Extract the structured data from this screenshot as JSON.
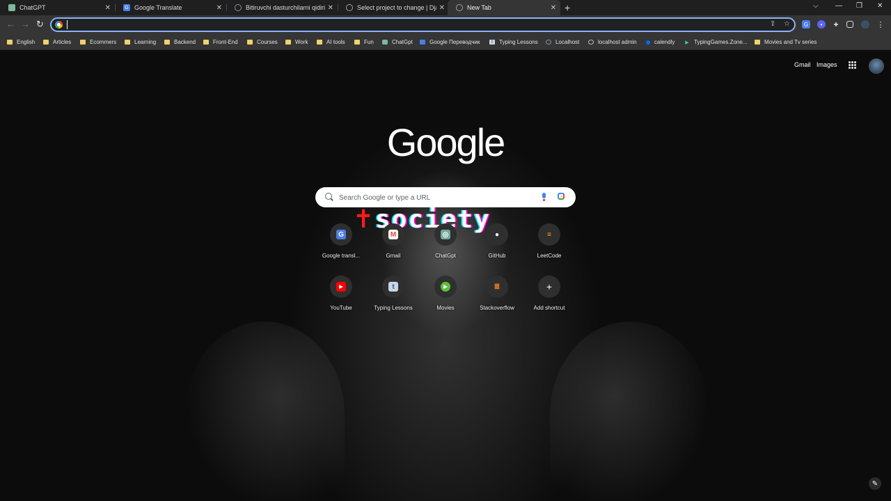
{
  "tabs": [
    {
      "label": "ChatGPT",
      "icon": "chatgpt-icon",
      "color": "#7fb89e",
      "active": false
    },
    {
      "label": "Google Translate",
      "icon": "translate-icon",
      "color": "#4a7de8",
      "active": false
    },
    {
      "label": "Bitiruvchi dasturchilarni qidirib t",
      "icon": "search-icon",
      "color": "#8a8fa8",
      "active": false
    },
    {
      "label": "Select project to change | Djang",
      "icon": "globe-icon",
      "color": "#a0a0a0",
      "active": false
    },
    {
      "label": "New Tab",
      "icon": "chrome-icon",
      "color": "#a0a0a0",
      "active": true
    }
  ],
  "omnibox": {
    "value": "",
    "placeholder": ""
  },
  "bookmarks": [
    {
      "label": "English",
      "type": "folder"
    },
    {
      "label": "Articles",
      "type": "folder"
    },
    {
      "label": "Ecommers",
      "type": "folder"
    },
    {
      "label": "Learning",
      "type": "folder"
    },
    {
      "label": "Backend",
      "type": "folder"
    },
    {
      "label": "Front-End",
      "type": "folder"
    },
    {
      "label": "Courses",
      "type": "folder"
    },
    {
      "label": "Work",
      "type": "folder"
    },
    {
      "label": "AI tools",
      "type": "folder"
    },
    {
      "label": "Fun",
      "type": "folder"
    },
    {
      "label": "ChatGpt",
      "type": "link"
    },
    {
      "label": "Google Переводчик",
      "type": "link"
    },
    {
      "label": "Typing Lessons",
      "type": "link"
    },
    {
      "label": "Localhost",
      "type": "link"
    },
    {
      "label": "localhost admin",
      "type": "link"
    },
    {
      "label": "calendly",
      "type": "link"
    },
    {
      "label": "TypingGames.Zone...",
      "type": "link"
    },
    {
      "label": "Movies and Tv series",
      "type": "folder"
    }
  ],
  "ntp": {
    "links": {
      "gmail": "Gmail",
      "images": "Images"
    },
    "logo": "Google",
    "search_placeholder": "Search Google or type a URL",
    "wallpaper_text": "society",
    "wallpaper_cross": "✝",
    "shortcuts": [
      {
        "label": "Google transl...",
        "icon": "google-translate-icon",
        "color": "#4a7de8",
        "glyph": "G"
      },
      {
        "label": "Gmail",
        "icon": "gmail-icon",
        "color": "#ea4335",
        "glyph": "M"
      },
      {
        "label": "ChatGpt",
        "icon": "chatgpt-icon",
        "color": "#74aa9c",
        "glyph": "◎"
      },
      {
        "label": "GitHub",
        "icon": "github-icon",
        "color": "#ffffff",
        "glyph": "●"
      },
      {
        "label": "LeetCode",
        "icon": "leetcode-icon",
        "color": "#ffa116",
        "glyph": "≡"
      },
      {
        "label": "YouTube",
        "icon": "youtube-icon",
        "color": "#ff0000",
        "glyph": "▶"
      },
      {
        "label": "Typing Lessons",
        "icon": "typing-lessons-icon",
        "color": "#c9d6e3",
        "glyph": "t"
      },
      {
        "label": "Movies",
        "icon": "movies-icon",
        "color": "#5fbf3a",
        "glyph": "▶"
      },
      {
        "label": "Stackoverflow",
        "icon": "stackoverflow-icon",
        "color": "#f48024",
        "glyph": "≣"
      },
      {
        "label": "Add shortcut",
        "icon": "plus-icon",
        "color": "#2f2f2f",
        "glyph": "+"
      }
    ]
  }
}
